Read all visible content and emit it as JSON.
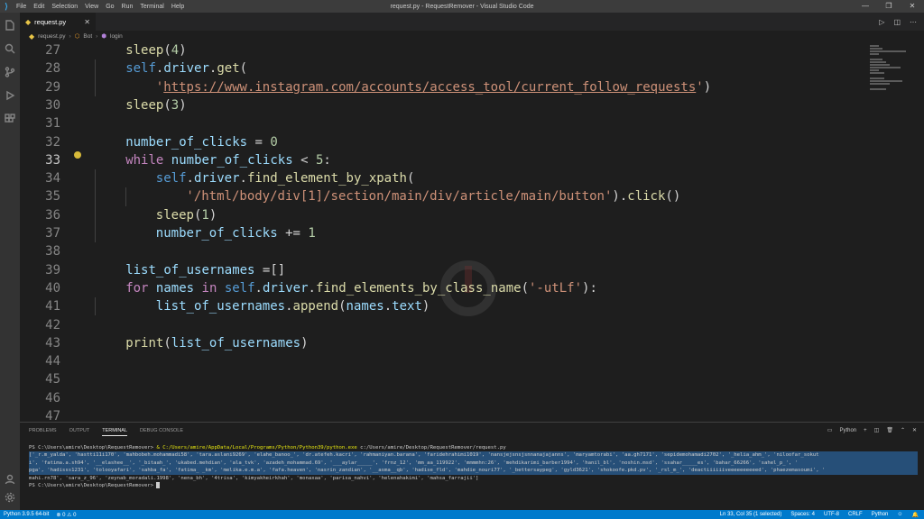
{
  "window": {
    "title": "request.py - RequestRemover - Visual Studio Code",
    "menu": [
      "File",
      "Edit",
      "Selection",
      "View",
      "Go",
      "Run",
      "Terminal",
      "Help"
    ],
    "controls": [
      "—",
      "❐",
      "✕"
    ]
  },
  "tabs": [
    {
      "label": "request.py",
      "close": "✕"
    }
  ],
  "breadcrumb": {
    "file": "request.py",
    "class_name": "Bot",
    "method": "login"
  },
  "editor": {
    "lines": [
      {
        "num": "27",
        "tokens": [
          {
            "t": "        "
          },
          {
            "c": "fn",
            "t": "sleep"
          },
          {
            "c": "plain",
            "t": "("
          },
          {
            "c": "num",
            "t": "4"
          },
          {
            "c": "plain",
            "t": ")"
          }
        ]
      },
      {
        "num": "28",
        "tokens": [
          {
            "t": "        "
          },
          {
            "c": "sf",
            "t": "self"
          },
          {
            "c": "plain",
            "t": "."
          },
          {
            "c": "var",
            "t": "driver"
          },
          {
            "c": "plain",
            "t": "."
          },
          {
            "c": "fn",
            "t": "get"
          },
          {
            "c": "plain",
            "t": "("
          }
        ]
      },
      {
        "num": "29",
        "tokens": [
          {
            "t": "            "
          },
          {
            "c": "str",
            "t": "'"
          },
          {
            "c": "str link",
            "t": "https://www.instagram.com/accounts/access_tool/current_follow_requests"
          },
          {
            "c": "str",
            "t": "'"
          },
          {
            "c": "plain",
            "t": ")"
          }
        ]
      },
      {
        "num": "30",
        "tokens": [
          {
            "t": "        "
          },
          {
            "c": "fn",
            "t": "sleep"
          },
          {
            "c": "plain",
            "t": "("
          },
          {
            "c": "num",
            "t": "3"
          },
          {
            "c": "plain",
            "t": ")"
          }
        ]
      },
      {
        "num": "31",
        "tokens": []
      },
      {
        "num": "32",
        "tokens": [
          {
            "t": "        "
          },
          {
            "c": "var",
            "t": "number_of_clicks"
          },
          {
            "c": "plain",
            "t": " = "
          },
          {
            "c": "num",
            "t": "0"
          }
        ]
      },
      {
        "num": "33",
        "tokens": [
          {
            "t": "        "
          },
          {
            "c": "kw",
            "t": "while"
          },
          {
            "c": "plain",
            "t": " "
          },
          {
            "c": "var",
            "t": "number_of_clicks"
          },
          {
            "c": "plain",
            "t": " < "
          },
          {
            "c": "num",
            "t": "5"
          },
          {
            "c": "plain",
            "t": ":"
          }
        ]
      },
      {
        "num": "34",
        "tokens": [
          {
            "t": "            "
          },
          {
            "c": "sf",
            "t": "self"
          },
          {
            "c": "plain",
            "t": "."
          },
          {
            "c": "var",
            "t": "driver"
          },
          {
            "c": "plain",
            "t": "."
          },
          {
            "c": "fn",
            "t": "find_element_by_xpath"
          },
          {
            "c": "plain",
            "t": "("
          }
        ]
      },
      {
        "num": "35",
        "tokens": [
          {
            "t": "                "
          },
          {
            "c": "str",
            "t": "'/html/body/div[1]/section/main/div/article/main/button'"
          },
          {
            "c": "plain",
            "t": ")."
          },
          {
            "c": "fn",
            "t": "click"
          },
          {
            "c": "plain",
            "t": "()"
          }
        ]
      },
      {
        "num": "36",
        "tokens": [
          {
            "t": "            "
          },
          {
            "c": "fn",
            "t": "sleep"
          },
          {
            "c": "plain",
            "t": "("
          },
          {
            "c": "num",
            "t": "1"
          },
          {
            "c": "plain",
            "t": ")"
          }
        ]
      },
      {
        "num": "37",
        "tokens": [
          {
            "t": "            "
          },
          {
            "c": "var",
            "t": "number_of_clicks"
          },
          {
            "c": "plain",
            "t": " += "
          },
          {
            "c": "num",
            "t": "1"
          }
        ]
      },
      {
        "num": "38",
        "tokens": []
      },
      {
        "num": "39",
        "tokens": [
          {
            "t": "        "
          },
          {
            "c": "var",
            "t": "list_of_usernames"
          },
          {
            "c": "plain",
            "t": " =[]"
          }
        ]
      },
      {
        "num": "40",
        "tokens": [
          {
            "t": "        "
          },
          {
            "c": "kw",
            "t": "for"
          },
          {
            "c": "plain",
            "t": " "
          },
          {
            "c": "var",
            "t": "names"
          },
          {
            "c": "plain",
            "t": " "
          },
          {
            "c": "kw",
            "t": "in"
          },
          {
            "c": "plain",
            "t": " "
          },
          {
            "c": "sf",
            "t": "self"
          },
          {
            "c": "plain",
            "t": "."
          },
          {
            "c": "var",
            "t": "driver"
          },
          {
            "c": "plain",
            "t": "."
          },
          {
            "c": "fn",
            "t": "find_elements_by_class_name"
          },
          {
            "c": "plain",
            "t": "("
          },
          {
            "c": "str",
            "t": "'-utLf'"
          },
          {
            "c": "plain",
            "t": "):"
          }
        ]
      },
      {
        "num": "41",
        "tokens": [
          {
            "t": "            "
          },
          {
            "c": "var",
            "t": "list_of_usernames"
          },
          {
            "c": "plain",
            "t": "."
          },
          {
            "c": "fn",
            "t": "append"
          },
          {
            "c": "plain",
            "t": "("
          },
          {
            "c": "var",
            "t": "names"
          },
          {
            "c": "plain",
            "t": "."
          },
          {
            "c": "var",
            "t": "text"
          },
          {
            "c": "plain",
            "t": ")"
          }
        ]
      },
      {
        "num": "42",
        "tokens": []
      },
      {
        "num": "43",
        "tokens": [
          {
            "t": "        "
          },
          {
            "c": "fn",
            "t": "print"
          },
          {
            "c": "plain",
            "t": "("
          },
          {
            "c": "var",
            "t": "list_of_usernames"
          },
          {
            "c": "plain",
            "t": ")"
          }
        ]
      },
      {
        "num": "44",
        "tokens": []
      },
      {
        "num": "45",
        "tokens": []
      },
      {
        "num": "46",
        "tokens": []
      },
      {
        "num": "47",
        "tokens": []
      }
    ],
    "active_line": "33"
  },
  "panel": {
    "tabs": [
      "PROBLEMS",
      "OUTPUT",
      "TERMINAL",
      "DEBUG CONSOLE"
    ],
    "active_tab": "TERMINAL",
    "shell": "Python",
    "terminal": {
      "prompt1": "PS C:\\Users\\amire\\Desktop\\RequestRemover>",
      "command_exe": "& C:/Users/amire/AppData/Local/Programs/Python/Python39/python.exe",
      "command_arg": "c:/Users/amire/Desktop/RequestRemover/request.py",
      "output_lines": [
        "['_r.m_yalda', 'hastti11i170', 'mahbobeh.mohammadi58', 'tara.aslani9269', 'elahe_banoo_', 'dr.atefeh.kacri', 'rahmaniyan.barana', 'faridehrahimi1019', 'nansjejsnsjsnnanajajanns', 'maryamtorabi', 'aa.gh7171', 'sepidemohamadi2702', '_helia_ahm_', 'niloofar_sokut",
        "i', 'fatima.a.sh94', '__elashee__', '_bitaah_', 'ukabed.mehdian', 'ala_tvk', 'azadeh_mohammad.69', '___aylar_____', 'frnz_12', 'mm_aa_119922', 'mmmmhn:26', 'mehdikarimi_barber1994', 'hanil_bl', 'noshin.msd', 'ssahar_____es', 'bahar_66266', 'sahel_p_', '",
        "pga', 'hadisss1231', 'tolooyafari', 'sahba_fa', 'fatima_ _km', 'melika.e.m.a', 'fafa.heaven', 'nasrin_zandian', '__asma__qb', 'hadise_fld', 'mahdie_nouri77', '_bettersaypeg', 'gyld3621', 'shokoofe.pkd.pv', '_rsl_m_', 'deactiiiiiiveeeeeeeeeed', 'phaezemasoumi', '",
        "mahi.rn78', 'sara_z_96', 'zeynab_moradali.1998', 'nena_bh', '4trisa', 'kimyakheirkhah', 'monaxaa', 'parisa_nahvi', 'helenahakimi', 'mahsa_farrajii']"
      ],
      "prompt2": "PS C:\\Users\\amire\\Desktop\\RequestRemover>"
    }
  },
  "statusbar": {
    "interpreter": "Python 3.9.5 64-bit",
    "problems": "⊗ 0  ⚠ 0",
    "position": "Ln 33, Col 35 (1 selected)",
    "spaces": "Spaces: 4",
    "encoding": "UTF-8",
    "eol": "CRLF",
    "language": "Python"
  },
  "colors": {
    "accent": "#007acc",
    "titlebar": "#3c3c3c",
    "editor_bg": "#1e1e1e"
  }
}
